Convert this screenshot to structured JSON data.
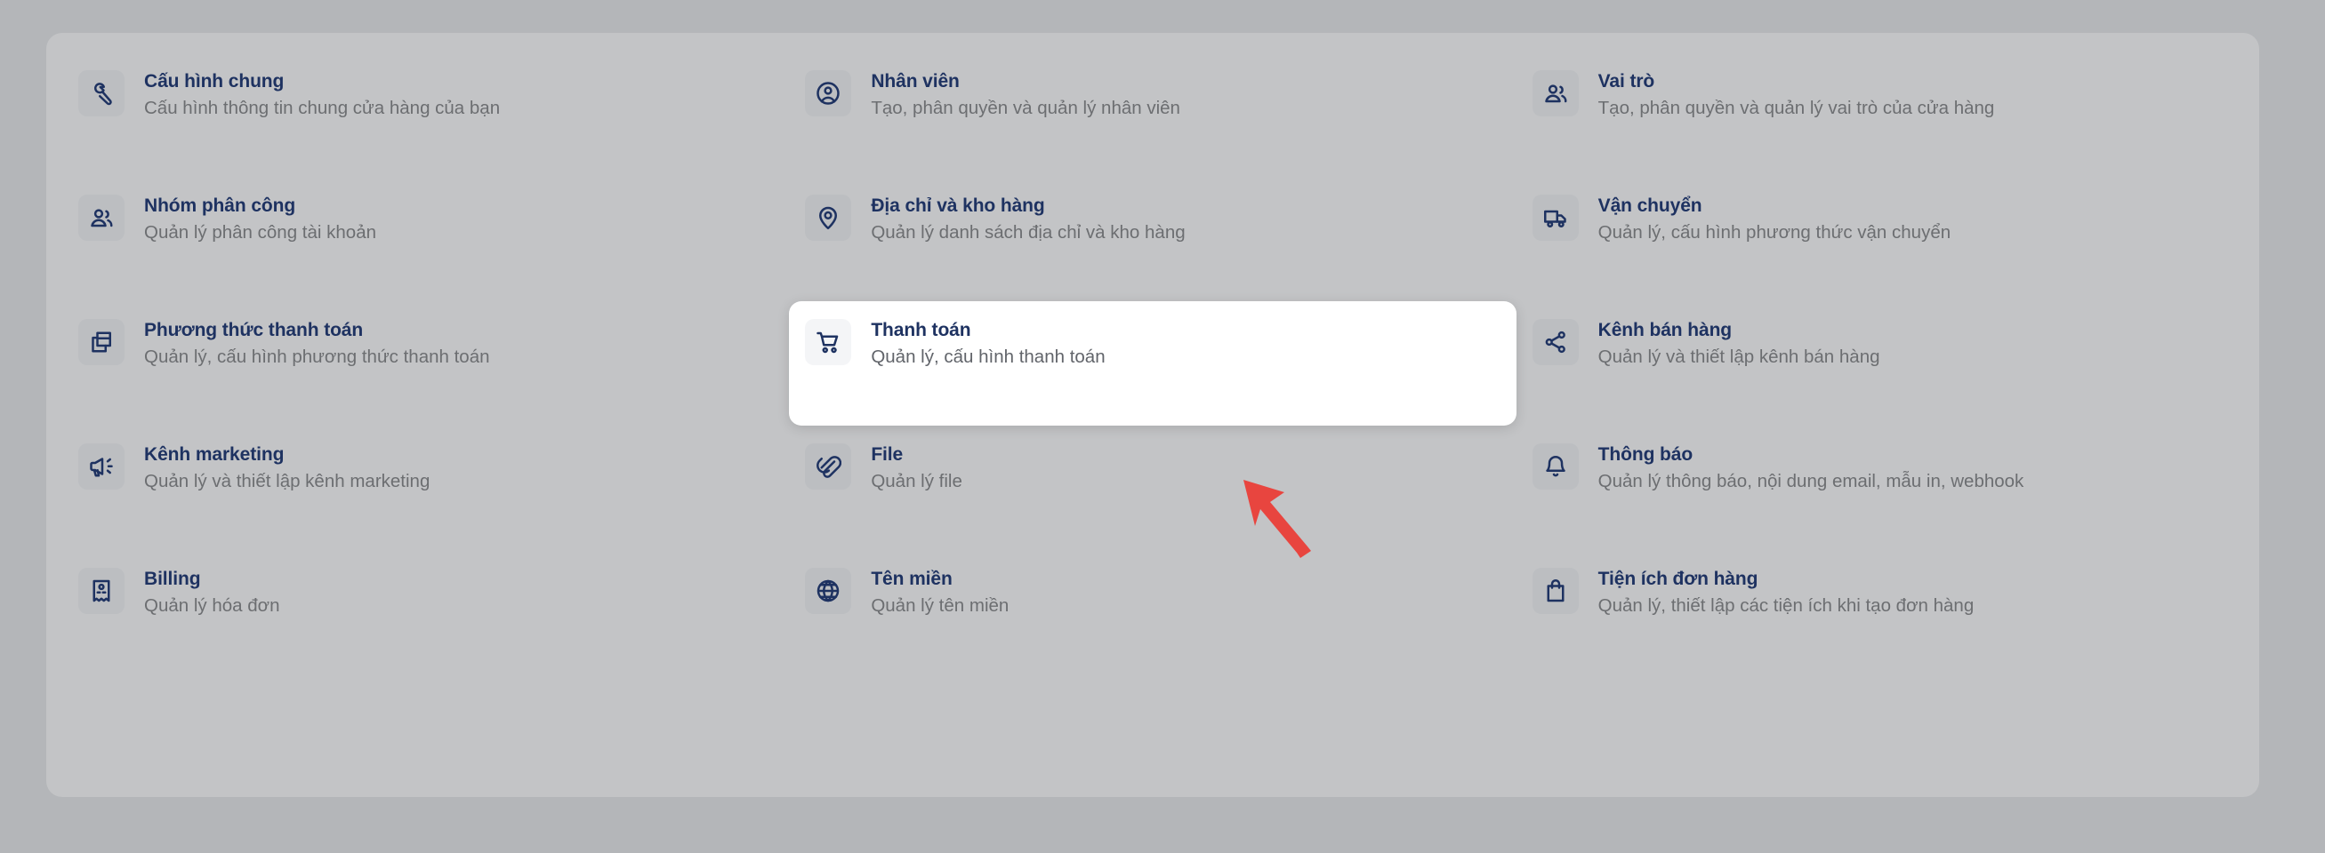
{
  "page": {
    "background_color": "#b4b6b9",
    "panel_color": "#c3c4c6",
    "accent_color": "#1e3261",
    "muted_text_color": "#6c6e71",
    "highlight_card_color": "#ffffff",
    "annotation_color": "#e8453f"
  },
  "settings_grid": {
    "items": [
      {
        "icon": "wrench-icon",
        "title": "Cấu hình chung",
        "description": "Cấu hình thông tin chung cửa hàng của bạn",
        "highlighted": false
      },
      {
        "icon": "user-circle-icon",
        "title": "Nhân viên",
        "description": "Tạo, phân quyền và quản lý nhân viên",
        "highlighted": false
      },
      {
        "icon": "users-icon",
        "title": "Vai trò",
        "description": "Tạo, phân quyền và quản lý vai trò của cửa hàng",
        "highlighted": false
      },
      {
        "icon": "users-group-icon",
        "title": "Nhóm phân công",
        "description": "Quản lý phân công tài khoản",
        "highlighted": false
      },
      {
        "icon": "map-pin-icon",
        "title": "Địa chỉ và kho hàng",
        "description": "Quản lý danh sách địa chỉ và kho hàng",
        "highlighted": false
      },
      {
        "icon": "truck-icon",
        "title": "Vận chuyển",
        "description": "Quản lý, cấu hình phương thức vận chuyển",
        "highlighted": false
      },
      {
        "icon": "cards-stack-icon",
        "title": "Phương thức thanh toán",
        "description": "Quản lý, cấu hình phương thức thanh toán",
        "highlighted": false
      },
      {
        "icon": "shopping-cart-icon",
        "title": "Thanh toán",
        "description": "Quản lý, cấu hình thanh toán",
        "highlighted": true
      },
      {
        "icon": "share-nodes-icon",
        "title": "Kênh bán hàng",
        "description": "Quản lý và thiết lập kênh bán hàng",
        "highlighted": false
      },
      {
        "icon": "megaphone-icon",
        "title": "Kênh marketing",
        "description": "Quản lý và thiết lập kênh marketing",
        "highlighted": false
      },
      {
        "icon": "paperclip-icon",
        "title": "File",
        "description": "Quản lý file",
        "highlighted": false
      },
      {
        "icon": "bell-icon",
        "title": "Thông báo",
        "description": "Quản lý thông báo, nội dung email, mẫu in, webhook",
        "highlighted": false
      },
      {
        "icon": "receipt-icon",
        "title": "Billing",
        "description": "Quản lý hóa đơn",
        "highlighted": false
      },
      {
        "icon": "globe-icon",
        "title": "Tên miền",
        "description": "Quản lý tên miền",
        "highlighted": false
      },
      {
        "icon": "shopping-bag-icon",
        "title": "Tiện ích đơn hàng",
        "description": "Quản lý, thiết lập các tiện ích khi tạo đơn hàng",
        "highlighted": false
      }
    ]
  },
  "annotation": {
    "type": "arrow",
    "points_to": "Thanh toán",
    "color": "#e8453f"
  }
}
